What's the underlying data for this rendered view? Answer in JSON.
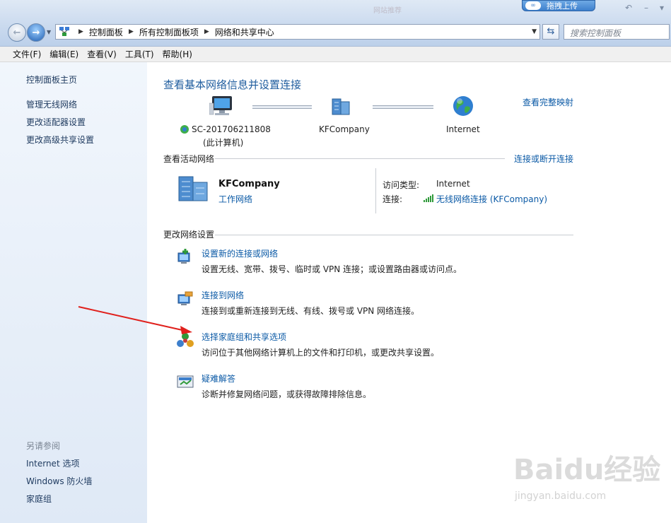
{
  "window": {
    "upload_label": "拖拽上传",
    "faded_tab": "网站推荐"
  },
  "nav": {
    "breadcrumbs": [
      "控制面板",
      "所有控制面板项",
      "网络和共享中心"
    ],
    "search_placeholder": "搜索控制面板"
  },
  "menu": [
    "文件(F)",
    "编辑(E)",
    "查看(V)",
    "工具(T)",
    "帮助(H)"
  ],
  "sidebar": {
    "home": "控制面板主页",
    "links": [
      "管理无线网络",
      "更改适配器设置",
      "更改高级共享设置"
    ],
    "see_also_title": "另请参阅",
    "see_also": [
      "Internet 选项",
      "Windows 防火墙",
      "家庭组"
    ]
  },
  "main": {
    "title": "查看基本网络信息并设置连接",
    "full_map_link": "查看完整映射",
    "map": {
      "computer_name": "SC-201706211808",
      "computer_sub": "(此计算机)",
      "network_name": "KFCompany",
      "internet": "Internet"
    },
    "active_section": "查看活动网络",
    "connect_link": "连接或断开连接",
    "active": {
      "name": "KFCompany",
      "type": "工作网络",
      "access_key": "访问类型:",
      "access_val": "Internet",
      "conn_key": "连接:",
      "conn_val": "无线网络连接 (KFCompany)"
    },
    "change_section": "更改网络设置",
    "tasks": [
      {
        "title": "设置新的连接或网络",
        "desc": "设置无线、宽带、拨号、临时或 VPN 连接；或设置路由器或访问点。"
      },
      {
        "title": "连接到网络",
        "desc": "连接到或重新连接到无线、有线、拨号或 VPN 网络连接。"
      },
      {
        "title": "选择家庭组和共享选项",
        "desc": "访问位于其他网络计算机上的文件和打印机，或更改共享设置。"
      },
      {
        "title": "疑难解答",
        "desc": "诊断并修复网络问题，或获得故障排除信息。"
      }
    ]
  },
  "watermark": {
    "brand": "Baidu经验",
    "url": "jingyan.baidu.com"
  }
}
